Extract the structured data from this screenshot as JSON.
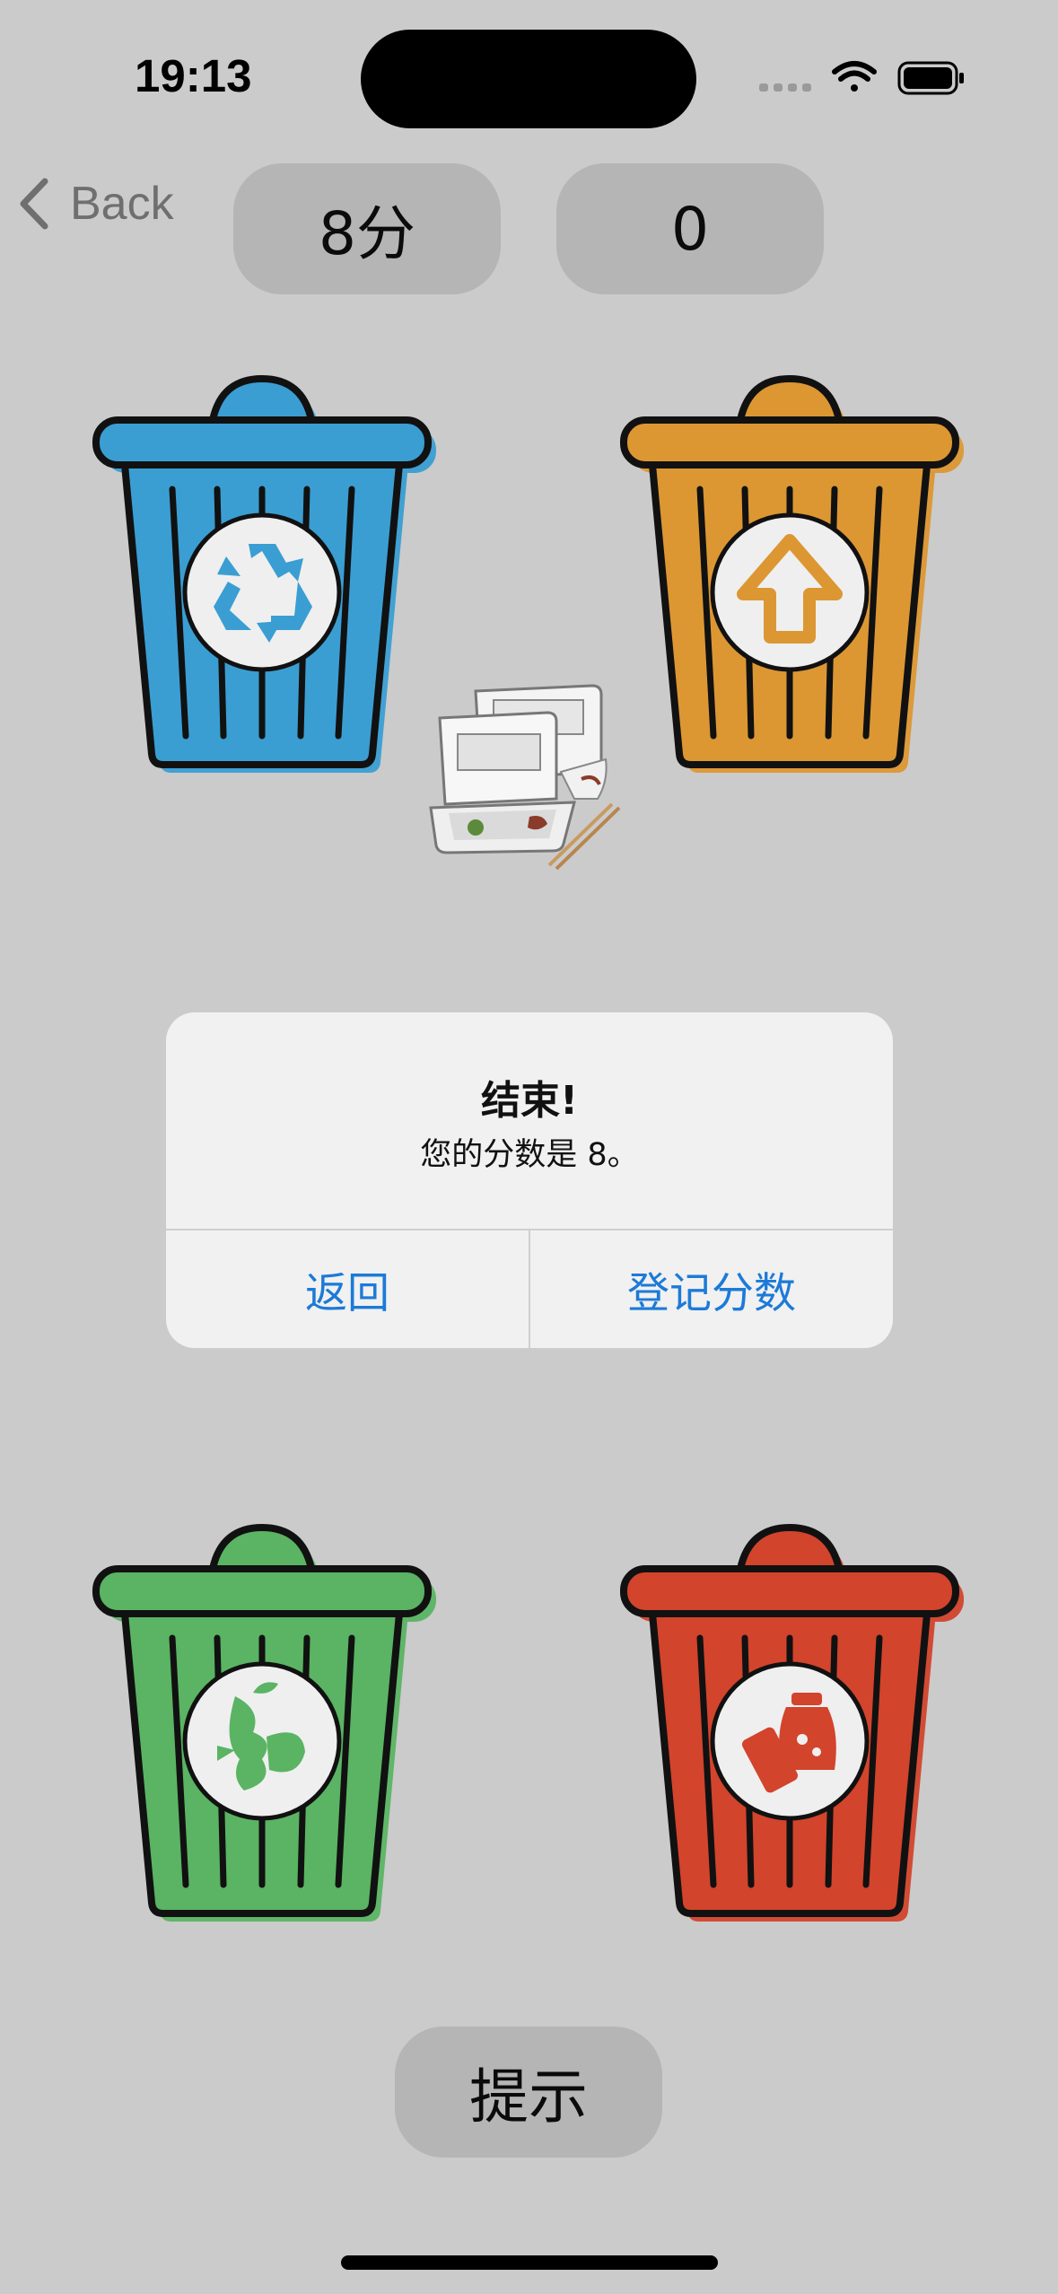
{
  "status_bar": {
    "time": "19:13"
  },
  "nav": {
    "back_label": "Back"
  },
  "header": {
    "score_label": "8分",
    "counter_label": "0"
  },
  "bins": [
    {
      "name": "recyclable",
      "color": "#3a9ed3",
      "icon": "recycle-icon"
    },
    {
      "name": "other",
      "color": "#dc9733",
      "icon": "arrow-up-icon"
    },
    {
      "name": "kitchen",
      "color": "#5ab463",
      "icon": "apple-core-icon"
    },
    {
      "name": "hazardous",
      "color": "#d2442c",
      "icon": "battery-bottle-icon"
    }
  ],
  "item": {
    "icon": "takeout-box-icon"
  },
  "alert": {
    "title": "结束!",
    "message": "您的分数是 8。",
    "cancel_label": "返回",
    "confirm_label": "登记分数"
  },
  "hint_button": {
    "label": "提示"
  },
  "colors": {
    "background": "#cbcbcb",
    "accent": "#1c7ad8"
  }
}
